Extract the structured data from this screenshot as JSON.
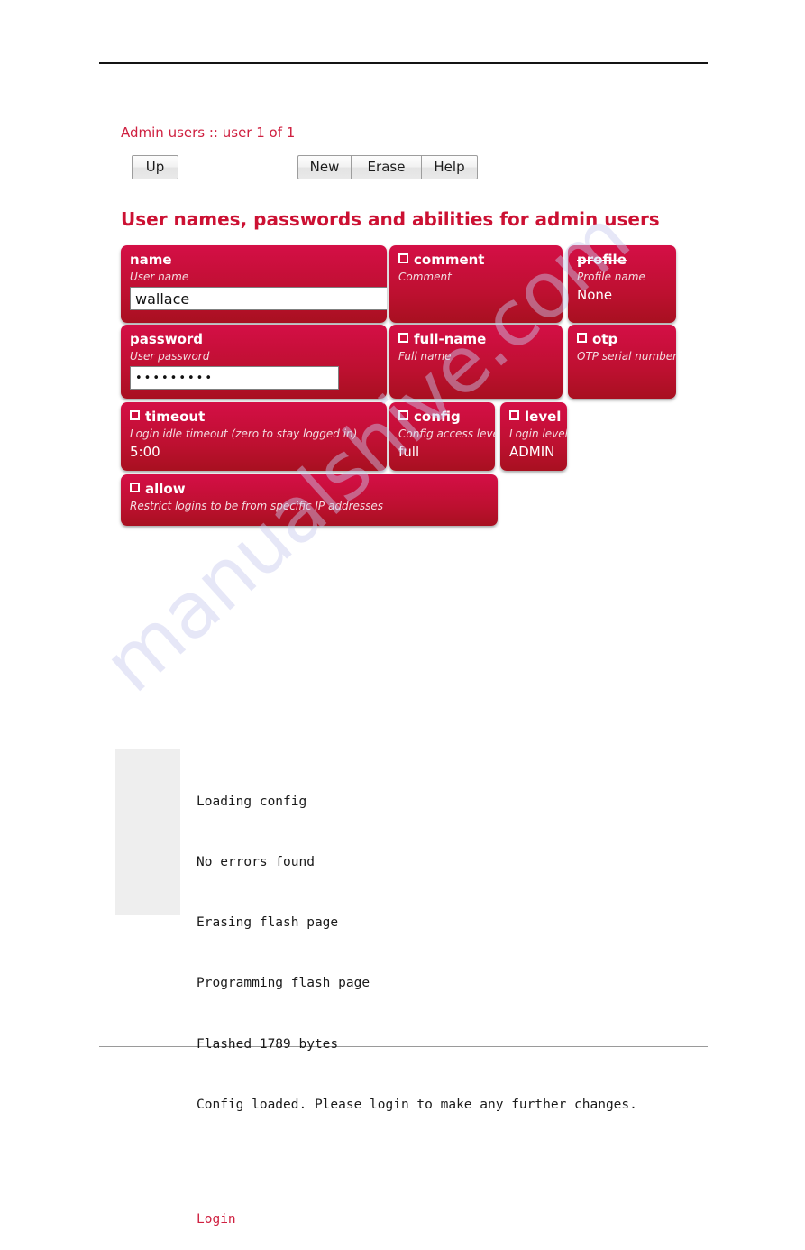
{
  "watermark": {
    "text": "manualshive.com"
  },
  "breadcrumb": {
    "text": "Admin users :: user 1 of 1"
  },
  "toolbar": {
    "up_label": "Up",
    "new_label": "New",
    "erase_label": "Erase",
    "help_label": "Help"
  },
  "section": {
    "title": "User names, passwords and abilities for admin users"
  },
  "fields": {
    "name": {
      "label": "name",
      "desc": "User name",
      "value": "wallace"
    },
    "comment": {
      "label": "comment",
      "desc": "Comment",
      "value": ""
    },
    "profile": {
      "label": "profile",
      "desc": "Profile name",
      "value": "None"
    },
    "password": {
      "label": "password",
      "desc": "User password",
      "value": "•••••••••"
    },
    "fullname": {
      "label": "full-name",
      "desc": "Full name",
      "value": ""
    },
    "otp": {
      "label": "otp",
      "desc": "OTP serial number",
      "value": ""
    },
    "timeout": {
      "label": "timeout",
      "desc": "Login idle timeout (zero to stay logged in)",
      "value": "5:00"
    },
    "config": {
      "label": "config",
      "desc": "Config access level",
      "value": "full"
    },
    "level": {
      "label": "level",
      "desc": "Login level",
      "value": "ADMIN"
    },
    "allow": {
      "label": "allow",
      "desc": "Restrict logins to be from specific IP addresses",
      "value": ""
    }
  },
  "console": {
    "lines": [
      "Loading config",
      "No errors found",
      "Erasing flash page",
      "Programming flash page",
      "Flashed 1789 bytes",
      "Config loaded. Please login to make any further changes."
    ],
    "line0": "Loading config",
    "line1": "No errors found",
    "line2": "Erasing flash page",
    "line3": "Programming flash page",
    "line4": "Flashed 1789 bytes",
    "line5": "Config loaded. Please login to make any further changes.",
    "login_link": "Login"
  },
  "colors": {
    "accent_red": "#cc1133",
    "box_red_top": "#d40f46",
    "box_red_bottom": "#a81020",
    "link_red": "#cf2040",
    "console_pad_gray": "#eeeeee",
    "watermark_blue": "#c9cbee"
  }
}
